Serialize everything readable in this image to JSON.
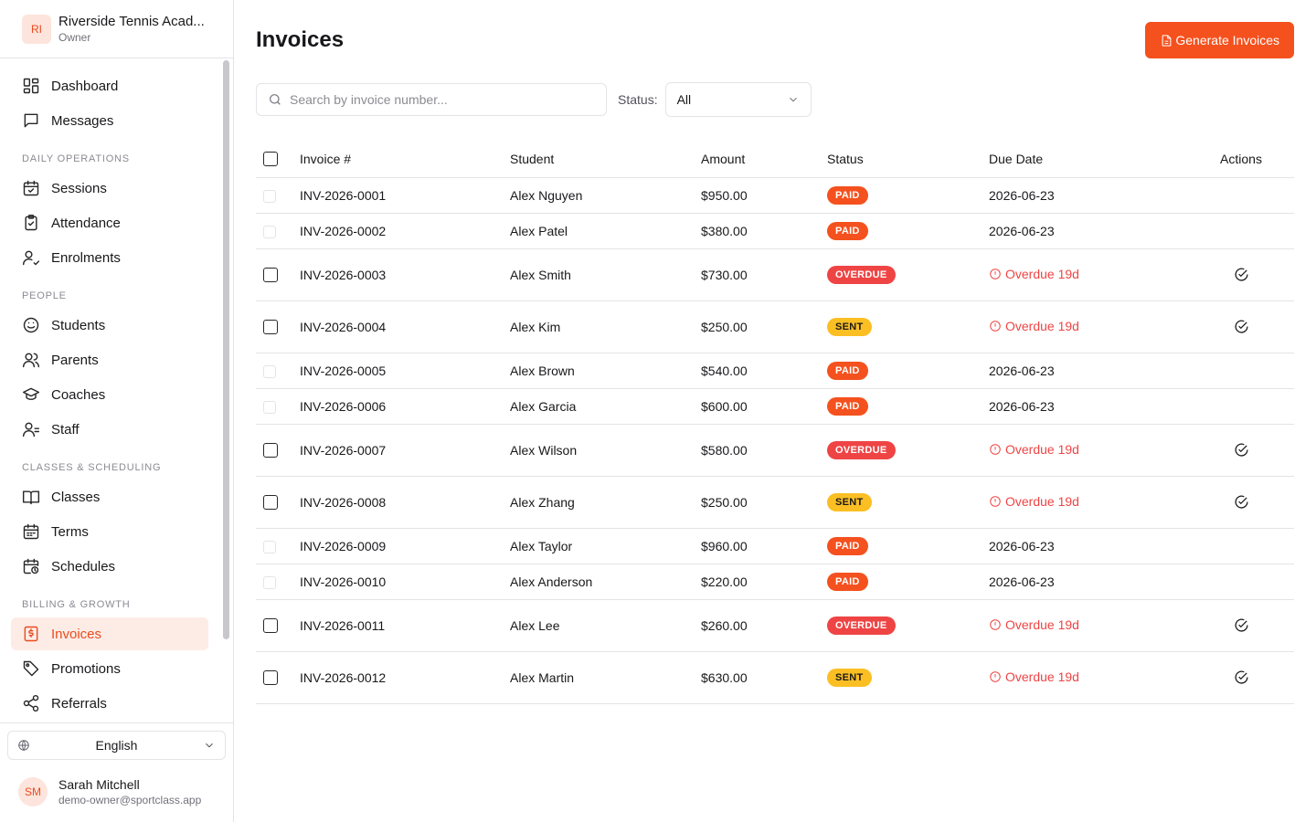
{
  "org": {
    "initials": "RI",
    "name": "Riverside Tennis Acad...",
    "role": "Owner"
  },
  "nav": {
    "top": [
      {
        "label": "Dashboard",
        "icon": "dashboard-icon"
      },
      {
        "label": "Messages",
        "icon": "message-icon"
      }
    ],
    "sections": [
      {
        "title": "DAILY OPERATIONS",
        "items": [
          {
            "label": "Sessions",
            "icon": "calendar-check-icon"
          },
          {
            "label": "Attendance",
            "icon": "clipboard-check-icon"
          },
          {
            "label": "Enrolments",
            "icon": "user-check-icon"
          }
        ]
      },
      {
        "title": "PEOPLE",
        "items": [
          {
            "label": "Students",
            "icon": "smile-icon"
          },
          {
            "label": "Parents",
            "icon": "users-icon"
          },
          {
            "label": "Coaches",
            "icon": "graduation-cap-icon"
          },
          {
            "label": "Staff",
            "icon": "staff-icon"
          }
        ]
      },
      {
        "title": "CLASSES & SCHEDULING",
        "items": [
          {
            "label": "Classes",
            "icon": "book-icon"
          },
          {
            "label": "Terms",
            "icon": "calendar-icon"
          },
          {
            "label": "Schedules",
            "icon": "calendar-clock-icon"
          }
        ]
      },
      {
        "title": "BILLING & GROWTH",
        "items": [
          {
            "label": "Invoices",
            "icon": "invoice-icon",
            "active": true
          },
          {
            "label": "Promotions",
            "icon": "tag-icon"
          },
          {
            "label": "Referrals",
            "icon": "share-icon"
          }
        ]
      }
    ]
  },
  "language": {
    "value": "English"
  },
  "user": {
    "initials": "SM",
    "name": "Sarah Mitchell",
    "email": "demo-owner@sportclass.app"
  },
  "page": {
    "title": "Invoices",
    "generate_label": "Generate Invoices"
  },
  "filters": {
    "search_placeholder": "Search by invoice number...",
    "status_label": "Status:",
    "status_value": "All"
  },
  "table": {
    "headers": [
      "Invoice #",
      "Student",
      "Amount",
      "Status",
      "Due Date",
      "Actions"
    ],
    "rows": [
      {
        "invoice": "INV-2026-0001",
        "student": "Alex Nguyen",
        "amount": "$950.00",
        "status": "PAID",
        "due": "2026-06-23"
      },
      {
        "invoice": "INV-2026-0002",
        "student": "Alex Patel",
        "amount": "$380.00",
        "status": "PAID",
        "due": "2026-06-23"
      },
      {
        "invoice": "INV-2026-0003",
        "student": "Alex Smith",
        "amount": "$730.00",
        "status": "OVERDUE",
        "due": "Overdue 19d"
      },
      {
        "invoice": "INV-2026-0004",
        "student": "Alex Kim",
        "amount": "$250.00",
        "status": "SENT",
        "due": "Overdue 19d"
      },
      {
        "invoice": "INV-2026-0005",
        "student": "Alex Brown",
        "amount": "$540.00",
        "status": "PAID",
        "due": "2026-06-23"
      },
      {
        "invoice": "INV-2026-0006",
        "student": "Alex Garcia",
        "amount": "$600.00",
        "status": "PAID",
        "due": "2026-06-23"
      },
      {
        "invoice": "INV-2026-0007",
        "student": "Alex Wilson",
        "amount": "$580.00",
        "status": "OVERDUE",
        "due": "Overdue 19d"
      },
      {
        "invoice": "INV-2026-0008",
        "student": "Alex Zhang",
        "amount": "$250.00",
        "status": "SENT",
        "due": "Overdue 19d"
      },
      {
        "invoice": "INV-2026-0009",
        "student": "Alex Taylor",
        "amount": "$960.00",
        "status": "PAID",
        "due": "2026-06-23"
      },
      {
        "invoice": "INV-2026-0010",
        "student": "Alex Anderson",
        "amount": "$220.00",
        "status": "PAID",
        "due": "2026-06-23"
      },
      {
        "invoice": "INV-2026-0011",
        "student": "Alex Lee",
        "amount": "$260.00",
        "status": "OVERDUE",
        "due": "Overdue 19d"
      },
      {
        "invoice": "INV-2026-0012",
        "student": "Alex Martin",
        "amount": "$630.00",
        "status": "SENT",
        "due": "Overdue 19d"
      }
    ]
  },
  "colors": {
    "accent": "#f4511e",
    "danger": "#ef4444",
    "warning": "#fbbf24"
  }
}
